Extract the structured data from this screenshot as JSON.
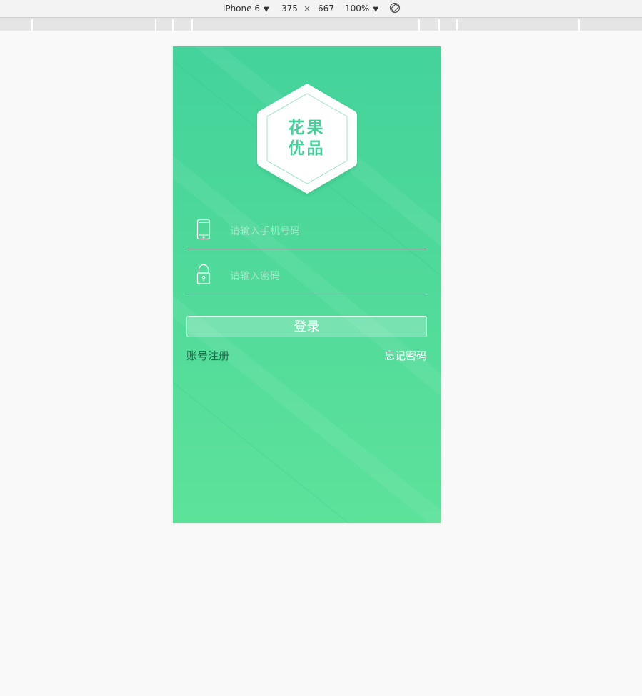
{
  "devtools": {
    "device": "iPhone 6",
    "width": "375",
    "times": "×",
    "height": "667",
    "zoom": "100%",
    "caret": "▼",
    "rotate_icon": "rotate-icon"
  },
  "app": {
    "logo_line1": "花果",
    "logo_line2": "优品",
    "phone_placeholder": "请输入手机号码",
    "password_placeholder": "请输入密码",
    "login_label": "登录",
    "register_label": "账号注册",
    "forgot_label": "忘记密码",
    "phone_icon": "mobile-phone-icon",
    "lock_icon": "lock-icon"
  },
  "colors": {
    "gradient_top": "#43d39b",
    "gradient_bottom": "#5de29a",
    "logo_text": "#45d09a",
    "register_text": "#1d6e4c",
    "page_background": "#f9f9f9"
  }
}
